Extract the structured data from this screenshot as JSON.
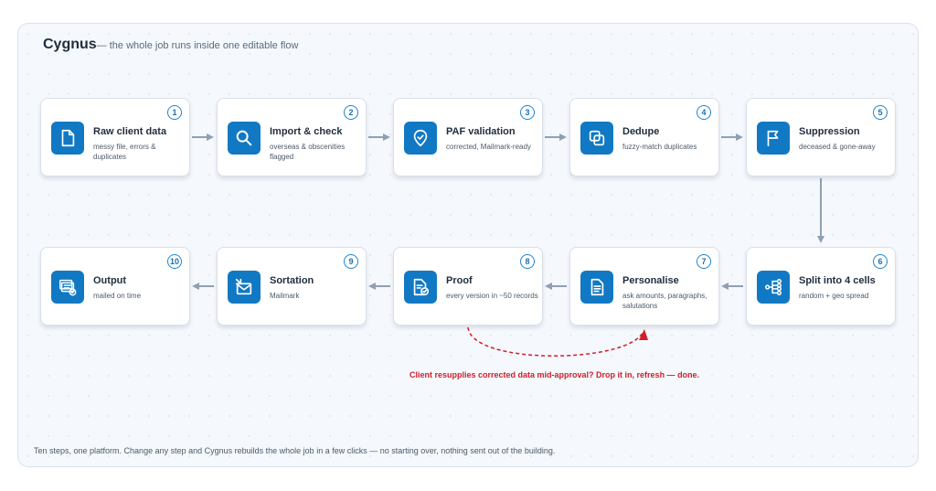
{
  "header": {
    "brand": "Cygnus",
    "subtitle": "— the whole job runs inside one editable flow"
  },
  "steps": [
    {
      "number": "1",
      "title": "Raw client data",
      "desc": "messy file, errors & duplicates",
      "icon": "document-icon"
    },
    {
      "number": "2",
      "title": "Import & check",
      "desc": "overseas & obscenities flagged",
      "icon": "search-icon"
    },
    {
      "number": "3",
      "title": "PAF validation",
      "desc": "corrected, Mailmark-ready",
      "icon": "shield-check-icon"
    },
    {
      "number": "4",
      "title": "Dedupe",
      "desc": "fuzzy-match duplicates",
      "icon": "overlap-squares-icon"
    },
    {
      "number": "5",
      "title": "Suppression",
      "desc": "deceased & gone-away",
      "icon": "flag-icon"
    },
    {
      "number": "6",
      "title": "Split into 4 cells",
      "desc": "random + geo spread",
      "icon": "split-tree-icon"
    },
    {
      "number": "7",
      "title": "Personalise",
      "desc": "ask amounts, paragraphs, salutations",
      "icon": "text-document-icon"
    },
    {
      "number": "8",
      "title": "Proof",
      "desc": "every version in ~50 records",
      "icon": "document-check-icon"
    },
    {
      "number": "9",
      "title": "Sortation",
      "desc": "Mailmark",
      "icon": "envelope-sort-icon"
    },
    {
      "number": "10",
      "title": "Output",
      "desc": "mailed on time",
      "icon": "stack-check-icon"
    }
  ],
  "annotation": "Client resupplies corrected data mid-approval? Drop it in, refresh — done.",
  "footer": "Ten steps, one platform. Change any step and Cygnus rebuilds the whole job in a few clicks — no starting over, nothing sent out of the building.",
  "colors": {
    "accent": "#1179c3",
    "arrow": "#8fa0b2",
    "loop": "#d21e2b"
  }
}
